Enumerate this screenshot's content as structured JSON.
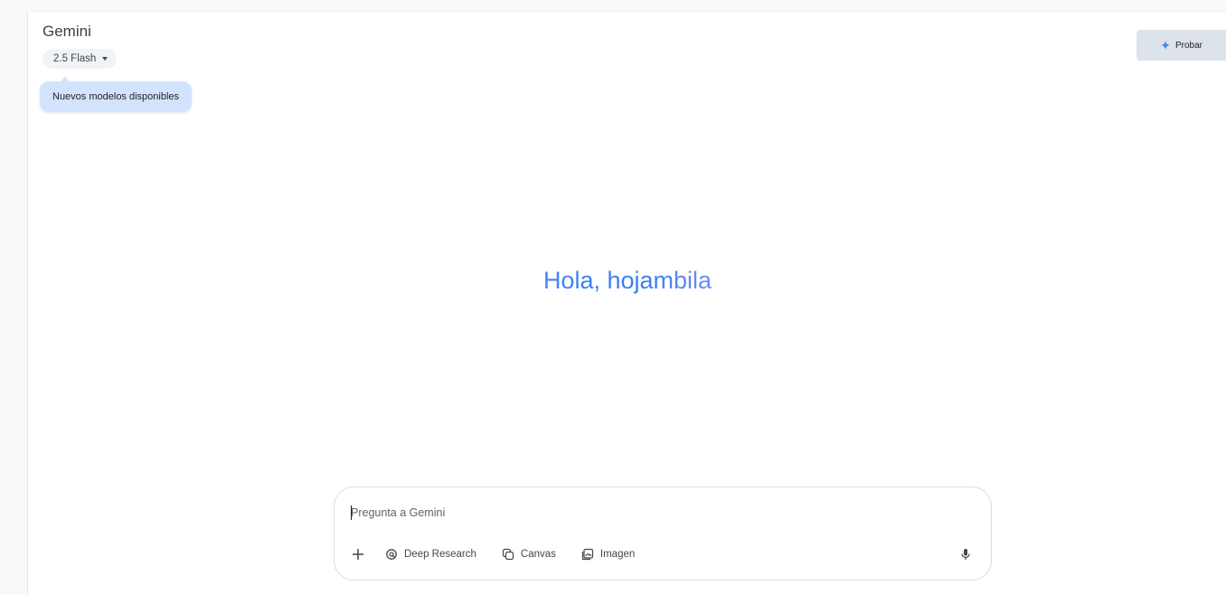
{
  "header": {
    "app_title": "Gemini",
    "model_selector": {
      "label": "2.5 Flash"
    },
    "tooltip": "Nuevos modelos disponibles",
    "upgrade_button": {
      "label": "Probar",
      "icon": "sparkle-icon"
    }
  },
  "main": {
    "greeting": "Hola, hojambila"
  },
  "composer": {
    "placeholder": "Pregunta a Gemini",
    "value": "",
    "tools": [
      {
        "label": "Deep Research",
        "icon": "deep-research-icon"
      },
      {
        "label": "Canvas",
        "icon": "canvas-icon"
      },
      {
        "label": "Imagen",
        "icon": "image-icon"
      }
    ],
    "add_icon": "plus-icon",
    "mic_icon": "microphone-icon"
  },
  "colors": {
    "accent": "#4285f4",
    "tooltip_bg": "#d3e3fd",
    "button_bg": "#dde3ea"
  }
}
